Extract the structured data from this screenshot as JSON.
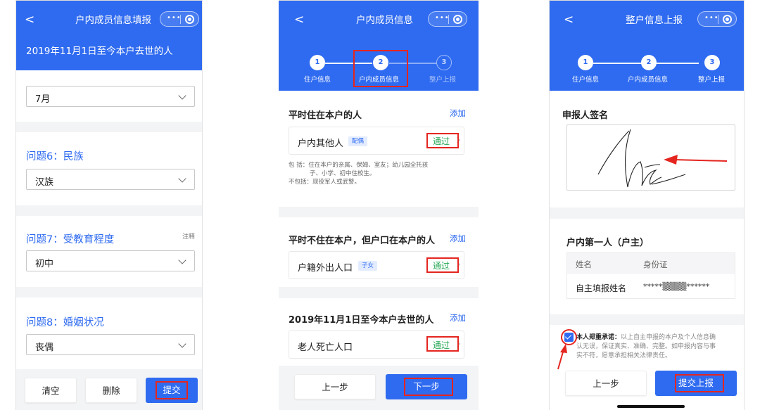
{
  "panel1": {
    "nav_back": "<",
    "nav_title": "户内成员信息填报",
    "header_subtitle": "2019年11月1日至今本户去世的人",
    "top_select_value": "7月",
    "q6_title": "问题6：民族",
    "q6_value": "汉族",
    "q7_title": "问题7：受教育程度",
    "q7_note": "注释",
    "q7_value": "初中",
    "q8_title": "问题8：婚姻状况",
    "q8_value": "丧偶",
    "btn_clear": "清空",
    "btn_delete": "删除",
    "btn_submit": "提交"
  },
  "panel2": {
    "nav_back": "<",
    "nav_title": "户内成员信息",
    "steps": [
      {
        "num": "1",
        "label": "住户信息"
      },
      {
        "num": "2",
        "label": "户内成员信息"
      },
      {
        "num": "3",
        "label": "整户上报"
      }
    ],
    "section1": {
      "title": "平时住在本户的人",
      "add": "添加",
      "card_name": "户内其他人",
      "card_tag": "配偶",
      "status": "通过",
      "note_line1": "包   括：住在本户的亲属、保姆、室友；幼儿园全托孩",
      "note_line2": "子、小学、初中住校生。",
      "note_line3": "不包括：现役军人或武警。"
    },
    "section2": {
      "title": "平时不住在本户，但户口在本户的人",
      "add": "添加",
      "card_name": "户籍外出人口",
      "card_tag": "子女",
      "status": "通过"
    },
    "section3": {
      "title": "2019年11月1日至今本户去世的人",
      "add": "添加",
      "card_name": "老人死亡人口",
      "status": "通过"
    },
    "btn_prev": "上一步",
    "btn_next": "下一步"
  },
  "panel3": {
    "nav_back": "<",
    "nav_title": "整户信息上报",
    "steps": [
      {
        "num": "1",
        "label": "住户信息"
      },
      {
        "num": "2",
        "label": "户内成员信息"
      },
      {
        "num": "3",
        "label": "整户上报"
      }
    ],
    "sign_title": "申报人签名",
    "head_title": "户内第一人（户主）",
    "col_name": "姓名",
    "col_id": "身份证",
    "row_name": "自主填报姓名",
    "row_id": "*****▒▒▒▒******",
    "promise_bold": "本人郑重承诺：",
    "promise_line1": "以上自主申报的本户及个人信息确",
    "promise_line2": "认无误，保证真实、准确、完整。如申报内容与事",
    "promise_line3": "实不符，愿意承担相关法律责任。",
    "btn_prev": "上一步",
    "btn_submit": "提交上报"
  },
  "colors": {
    "primary": "#2f6bf0",
    "pass": "#22a650",
    "highlight": "#e5251f"
  }
}
